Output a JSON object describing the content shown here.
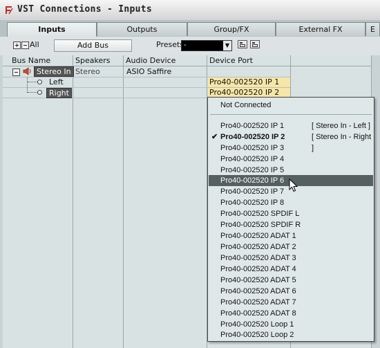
{
  "window": {
    "title": "VST Connections - Inputs"
  },
  "tabs": [
    {
      "label": "Inputs",
      "active": true
    },
    {
      "label": "Outputs",
      "active": false
    },
    {
      "label": "Group/FX",
      "active": false
    },
    {
      "label": "External FX",
      "active": false
    },
    {
      "label": "E",
      "active": false
    }
  ],
  "toolbar": {
    "all_label": "All",
    "add_bus_label": "Add Bus",
    "presets_label": "Presets",
    "presets_value": "-"
  },
  "columns": [
    "Bus Name",
    "Speakers",
    "Audio Device",
    "Device Port"
  ],
  "rows": [
    {
      "bus": "Stereo In",
      "speakers": "Stereo",
      "device": "ASIO Saffire",
      "port": ""
    },
    {
      "bus": "Left",
      "speakers": "",
      "device": "",
      "port": "Pro40-002520 IP 1"
    },
    {
      "bus": "Right",
      "speakers": "",
      "device": "",
      "port": "Pro40-002520 IP 2"
    }
  ],
  "dropdown": {
    "not_connected": "Not Connected",
    "items": [
      {
        "label": "Pro40-002520 IP 1",
        "assigned": "[ Stereo In - Left ]"
      },
      {
        "label": "Pro40-002520 IP 2",
        "assigned": "[ Stereo In - Right ]",
        "selected": true
      },
      {
        "label": "Pro40-002520 IP 3"
      },
      {
        "label": "Pro40-002520 IP 4"
      },
      {
        "label": "Pro40-002520 IP 5"
      },
      {
        "label": "Pro40-002520 IP 6",
        "hover": true
      },
      {
        "label": "Pro40-002520 IP 7"
      },
      {
        "label": "Pro40-002520 IP 8"
      },
      {
        "label": "Pro40-002520 SPDIF L"
      },
      {
        "label": "Pro40-002520 SPDIF R"
      },
      {
        "label": "Pro40-002520 ADAT 1"
      },
      {
        "label": "Pro40-002520 ADAT 2"
      },
      {
        "label": "Pro40-002520 ADAT 3"
      },
      {
        "label": "Pro40-002520 ADAT 4"
      },
      {
        "label": "Pro40-002520 ADAT 5"
      },
      {
        "label": "Pro40-002520 ADAT 6"
      },
      {
        "label": "Pro40-002520 ADAT 7"
      },
      {
        "label": "Pro40-002520 ADAT 8"
      },
      {
        "label": "Pro40-002520 Loop 1"
      },
      {
        "label": "Pro40-002520 Loop 2"
      }
    ],
    "check_glyph": "✔"
  },
  "colors": {
    "port_highlight": "#f6e7a8",
    "hover_row": "#556060",
    "app_icon": "#c0282d"
  },
  "icons": [
    "app-logo-icon",
    "expand-all-icon",
    "collapse-all-icon",
    "dropdown-arrow-icon",
    "save-preset-icon",
    "delete-preset-icon",
    "speaker-icon",
    "mouse-cursor-icon"
  ]
}
